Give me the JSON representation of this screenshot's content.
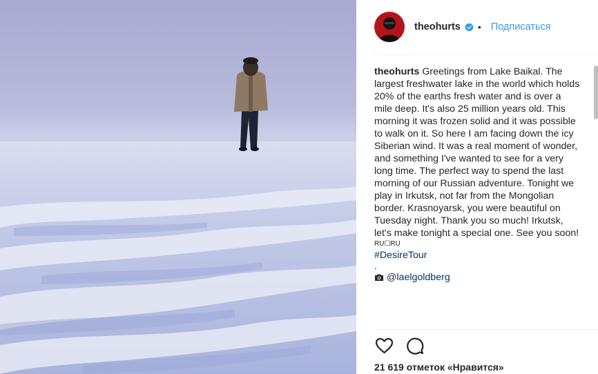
{
  "post": {
    "username": "theohurts",
    "separator": "•",
    "follow_label": "Подписаться"
  },
  "caption": {
    "username": "theohurts",
    "text": "Greetings from Lake Baikal. The largest freshwater lake in the world which holds 20% of the earths fresh water and is over a mile deep. It's also 25 million years old. This morning it was frozen solid and it was possible to walk on it. So here I am facing down the icy Siberian wind. It was a real moment of wonder, and something I've wanted to see for a very long time. The perfect way to spend the last morning of our Russian adventure. Tonight we play in Irkutsk, not far from the Mongolian border. Krasnoyarsk, you were beautiful on Tuesday night. Thank you so much! Irkutsk, let's make tonight a special one. See you soon!",
    "flag_text": "RU☐RU",
    "hashtag": "#DesireTour",
    "dot": ".",
    "credit_mention": "@laelgoldberg"
  },
  "icons": {
    "verified": "verified-badge-icon",
    "camera": "camera-icon",
    "like": "heart-icon",
    "comment": "comment-icon"
  },
  "likes": {
    "count": "21 619",
    "label": "отметок «Нравится»"
  },
  "colors": {
    "link": "#3897f0",
    "hashtag": "#003569",
    "text": "#262626"
  }
}
